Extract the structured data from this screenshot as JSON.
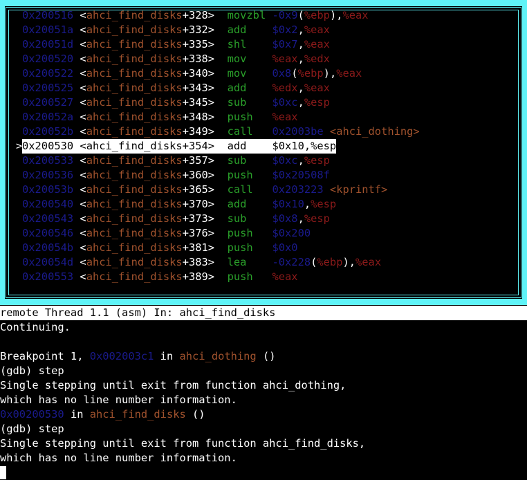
{
  "asm": {
    "lines": [
      {
        "addr": "0x200516",
        "func": "ahci_find_disks",
        "offset": "+328",
        "op": "movzbl",
        "args": [
          [
            "num",
            "-0x9"
          ],
          [
            "sep",
            "("
          ],
          [
            "reg",
            "%ebp"
          ],
          [
            "sep",
            "),"
          ],
          [
            "reg",
            "%eax"
          ]
        ],
        "current": false
      },
      {
        "addr": "0x20051a",
        "func": "ahci_find_disks",
        "offset": "+332",
        "op": "add",
        "args": [
          [
            "num",
            "$0x2"
          ],
          [
            "sep",
            ","
          ],
          [
            "reg",
            "%eax"
          ]
        ],
        "current": false
      },
      {
        "addr": "0x20051d",
        "func": "ahci_find_disks",
        "offset": "+335",
        "op": "shl",
        "args": [
          [
            "num",
            "$0x7"
          ],
          [
            "sep",
            ","
          ],
          [
            "reg",
            "%eax"
          ]
        ],
        "current": false
      },
      {
        "addr": "0x200520",
        "func": "ahci_find_disks",
        "offset": "+338",
        "op": "mov",
        "args": [
          [
            "reg",
            "%eax"
          ],
          [
            "sep",
            ","
          ],
          [
            "reg",
            "%edx"
          ]
        ],
        "current": false
      },
      {
        "addr": "0x200522",
        "func": "ahci_find_disks",
        "offset": "+340",
        "op": "mov",
        "args": [
          [
            "num",
            "0x8"
          ],
          [
            "sep",
            "("
          ],
          [
            "reg",
            "%ebp"
          ],
          [
            "sep",
            "),"
          ],
          [
            "reg",
            "%eax"
          ]
        ],
        "current": false
      },
      {
        "addr": "0x200525",
        "func": "ahci_find_disks",
        "offset": "+343",
        "op": "add",
        "args": [
          [
            "reg",
            "%edx"
          ],
          [
            "sep",
            ","
          ],
          [
            "reg",
            "%eax"
          ]
        ],
        "current": false
      },
      {
        "addr": "0x200527",
        "func": "ahci_find_disks",
        "offset": "+345",
        "op": "sub",
        "args": [
          [
            "num",
            "$0xc"
          ],
          [
            "sep",
            ","
          ],
          [
            "reg",
            "%esp"
          ]
        ],
        "current": false
      },
      {
        "addr": "0x20052a",
        "func": "ahci_find_disks",
        "offset": "+348",
        "op": "push",
        "args": [
          [
            "reg",
            "%eax"
          ]
        ],
        "current": false
      },
      {
        "addr": "0x20052b",
        "func": "ahci_find_disks",
        "offset": "+349",
        "op": "call",
        "args": [
          [
            "num",
            "0x2003be"
          ],
          [
            "sep",
            " "
          ],
          [
            "sym",
            "<ahci_dothing>"
          ]
        ],
        "current": false
      },
      {
        "addr": "0x200530",
        "func": "ahci_find_disks",
        "offset": "+354",
        "op": "add",
        "args": [
          [
            "num",
            "$0x10"
          ],
          [
            "sep",
            ","
          ],
          [
            "reg",
            "%esp"
          ]
        ],
        "current": true
      },
      {
        "addr": "0x200533",
        "func": "ahci_find_disks",
        "offset": "+357",
        "op": "sub",
        "args": [
          [
            "num",
            "$0xc"
          ],
          [
            "sep",
            ","
          ],
          [
            "reg",
            "%esp"
          ]
        ],
        "current": false
      },
      {
        "addr": "0x200536",
        "func": "ahci_find_disks",
        "offset": "+360",
        "op": "push",
        "args": [
          [
            "num",
            "$0x20508f"
          ]
        ],
        "current": false
      },
      {
        "addr": "0x20053b",
        "func": "ahci_find_disks",
        "offset": "+365",
        "op": "call",
        "args": [
          [
            "num",
            "0x203223"
          ],
          [
            "sep",
            " "
          ],
          [
            "sym",
            "<kprintf>"
          ]
        ],
        "current": false
      },
      {
        "addr": "0x200540",
        "func": "ahci_find_disks",
        "offset": "+370",
        "op": "add",
        "args": [
          [
            "num",
            "$0x10"
          ],
          [
            "sep",
            ","
          ],
          [
            "reg",
            "%esp"
          ]
        ],
        "current": false
      },
      {
        "addr": "0x200543",
        "func": "ahci_find_disks",
        "offset": "+373",
        "op": "sub",
        "args": [
          [
            "num",
            "$0x8"
          ],
          [
            "sep",
            ","
          ],
          [
            "reg",
            "%esp"
          ]
        ],
        "current": false
      },
      {
        "addr": "0x200546",
        "func": "ahci_find_disks",
        "offset": "+376",
        "op": "push",
        "args": [
          [
            "num",
            "$0x200"
          ]
        ],
        "current": false
      },
      {
        "addr": "0x20054b",
        "func": "ahci_find_disks",
        "offset": "+381",
        "op": "push",
        "args": [
          [
            "num",
            "$0x0"
          ]
        ],
        "current": false
      },
      {
        "addr": "0x20054d",
        "func": "ahci_find_disks",
        "offset": "+383",
        "op": "lea",
        "args": [
          [
            "num",
            "-0x228"
          ],
          [
            "sep",
            "("
          ],
          [
            "reg",
            "%ebp"
          ],
          [
            "sep",
            "),"
          ],
          [
            "reg",
            "%eax"
          ]
        ],
        "current": false
      },
      {
        "addr": "0x200553",
        "func": "ahci_find_disks",
        "offset": "+389",
        "op": "push",
        "args": [
          [
            "reg",
            "%eax"
          ]
        ],
        "current": false
      }
    ]
  },
  "status": {
    "text": "remote Thread 1.1 (asm) In: ahci_find_disks"
  },
  "console": {
    "lines": [
      [
        [
          "t",
          "Continuing."
        ]
      ],
      [
        [
          "t",
          ""
        ]
      ],
      [
        [
          "t",
          "Breakpoint 1, "
        ],
        [
          "a",
          "0x002003c1"
        ],
        [
          "t",
          " in "
        ],
        [
          "f",
          "ahci_dothing"
        ],
        [
          "t",
          " ()"
        ]
      ],
      [
        [
          "t",
          "(gdb) step"
        ]
      ],
      [
        [
          "t",
          "Single stepping until exit from function ahci_dothing,"
        ]
      ],
      [
        [
          "t",
          "which has no line number information."
        ]
      ],
      [
        [
          "a",
          "0x00200530"
        ],
        [
          "t",
          " in "
        ],
        [
          "f",
          "ahci_find_disks"
        ],
        [
          "t",
          " ()"
        ]
      ],
      [
        [
          "t",
          "(gdb) step"
        ]
      ],
      [
        [
          "t",
          "Single stepping until exit from function ahci_find_disks,"
        ]
      ],
      [
        [
          "t",
          "which has no line number information."
        ]
      ]
    ]
  },
  "marker": ">",
  "colors": {
    "frame": "#5ff3f7",
    "address": "#1a1a8c",
    "function": "#a0522d",
    "opcode": "#2aa02a",
    "register": "#8b1a1a"
  }
}
